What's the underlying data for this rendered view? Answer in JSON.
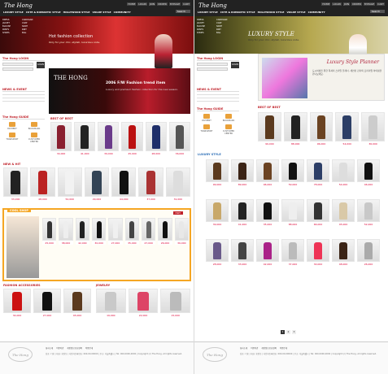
{
  "left": {
    "logo": "The Hong",
    "utils": [
      "HOME",
      "LOGIN",
      "JOIN",
      "ORDER",
      "MYPAGE",
      "CART"
    ],
    "nav": [
      "LUXURY STYLE",
      "CUTE & ROMANTIC STYLE",
      "HOLLYWOOD STYLE",
      "VOGUE STYLE",
      "COMMUNITY"
    ],
    "search": "Search",
    "categories": [
      "DRESS",
      "CARDIGAN",
      "JACKET",
      "COAT",
      "BLOUSE",
      "SKIRT",
      "PANTS",
      "KNIT",
      "SHOES",
      "BAG"
    ],
    "hero_title": "Hot fashion collection",
    "hero_sub": "Only for your chic, stylish, luxurious code.",
    "login_title": "The Hong LOGIN",
    "login_btn": "LOGIN",
    "news_title": "NEWS & EVENT",
    "guide_title": "The Hong GUIDE",
    "guide": [
      "PAYMENT",
      "BOOKMARK",
      "TRANSPORT",
      "CUSTOMER CENTER"
    ],
    "banner_brand": "THE HONG",
    "banner_title": "2006 F/W Fashion trend item",
    "banner_sub": "Luxury and premium fashion collection for the new season.",
    "best_title": "BEST OF BEST",
    "new_title": "NEW & HIT",
    "cool_title": "COOL SHOP",
    "cool_hot": "HOT",
    "acc_title": "FASHION ACCESSORIES",
    "jewelry_title": "JEWELRY",
    "best": [
      {
        "price": "34,000",
        "c": "#8a2030"
      },
      {
        "price": "41,000",
        "c": "#222"
      },
      {
        "price": "39,000",
        "c": "#6a3b8a"
      },
      {
        "price": "45,000",
        "c": "#b11"
      },
      {
        "price": "28,000",
        "c": "#1f2f6a"
      },
      {
        "price": "36,000",
        "c": "#555"
      }
    ],
    "new": [
      {
        "price": "33,000",
        "c": "#222"
      },
      {
        "price": "48,000",
        "c": "#b22"
      },
      {
        "price": "52,000",
        "c": "#f2f2f2"
      },
      {
        "price": "29,000",
        "c": "#345"
      },
      {
        "price": "44,000",
        "c": "#111"
      },
      {
        "price": "37,000",
        "c": "#a33"
      },
      {
        "price": "31,000",
        "c": "#ddd"
      }
    ],
    "cool": [
      {
        "price": "25,000",
        "c": "#333"
      },
      {
        "price": "38,000",
        "c": "#eee"
      },
      {
        "price": "42,000",
        "c": "#222"
      },
      {
        "price": "30,000",
        "c": "#111"
      },
      {
        "price": "27,000",
        "c": "#f0f0f0"
      },
      {
        "price": "35,000",
        "c": "#444"
      },
      {
        "price": "47,000",
        "c": "#666"
      },
      {
        "price": "26,000",
        "c": "#111"
      },
      {
        "price": "39,000",
        "c": "#e8e8e8"
      }
    ],
    "acc": [
      {
        "price": "34,000",
        "c": "#c11"
      },
      {
        "price": "27,000",
        "c": "#111"
      },
      {
        "price": "45,000",
        "c": "#5b3a1e"
      }
    ],
    "jewelry": [
      {
        "price": "19,000",
        "c": "#c9c9c9"
      },
      {
        "price": "22,000",
        "c": "#d46"
      },
      {
        "price": "15,000",
        "c": "#bbb"
      }
    ],
    "footer_links": [
      "회사소개",
      "이용약관",
      "개인정보보호정책",
      "이용안내"
    ],
    "footer_addr": "상호: 더홍 | 대표: 홍길동 | 사업자등록번호: 000-00-00000 | 주소: 서울특별시 | Tel: 000-0000-0000 | Copyright (c) The Hong. All rights reserved."
  },
  "right": {
    "logo": "The Hong",
    "hero_title": "LUXURY STYLE",
    "hero_sub": "Only for your chic, stylish, luxurious code.",
    "login_title": "The Hong LOGIN",
    "news_title": "NEWS & EVENT",
    "guide_title": "The Hong GUIDE",
    "planner_title": "Luxury Style Planner",
    "planner_sub": "도시여성을 위한 럭셔리 스타일 플래너. 세련된 감각의 프리미엄 아이템을 만나보세요.",
    "best_title": "BEST OF BEST",
    "luxury_title": "LUXURY STYLE",
    "best": [
      {
        "price": "99,000",
        "c": "#5b3a1e"
      },
      {
        "price": "88,000",
        "c": "#222"
      },
      {
        "price": "96,000",
        "c": "#6b4322"
      },
      {
        "price": "54,000",
        "c": "#2c3e66"
      },
      {
        "price": "36,000",
        "c": "#ccc"
      }
    ],
    "luxury": [
      {
        "price": "99,000",
        "c": "#5b3a1e"
      },
      {
        "price": "89,000",
        "c": "#3b2416"
      },
      {
        "price": "96,000",
        "c": "#6b4322"
      },
      {
        "price": "59,000",
        "c": "#111"
      },
      {
        "price": "78,000",
        "c": "#2c3e66"
      },
      {
        "price": "54,000",
        "c": "#ddd"
      },
      {
        "price": "46,000",
        "c": "#111"
      },
      {
        "price": "39,000",
        "c": "#c8a86a"
      },
      {
        "price": "41,000",
        "c": "#222"
      },
      {
        "price": "35,000",
        "c": "#111"
      },
      {
        "price": "88,000",
        "c": "#eee"
      },
      {
        "price": "66,000",
        "c": "#333"
      },
      {
        "price": "45,000",
        "c": "#d9c9a8"
      },
      {
        "price": "52,000",
        "c": "#c8c8c8"
      },
      {
        "price": "28,000",
        "c": "#6a5a8a"
      },
      {
        "price": "33,000",
        "c": "#444"
      },
      {
        "price": "42,000",
        "c": "#a28"
      },
      {
        "price": "37,000",
        "c": "#bbb"
      },
      {
        "price": "30,000",
        "c": "#e35"
      },
      {
        "price": "48,000",
        "c": "#3b2416"
      },
      {
        "price": "26,000",
        "c": "#aaa"
      }
    ],
    "pager": [
      "1",
      "2",
      "3"
    ]
  }
}
